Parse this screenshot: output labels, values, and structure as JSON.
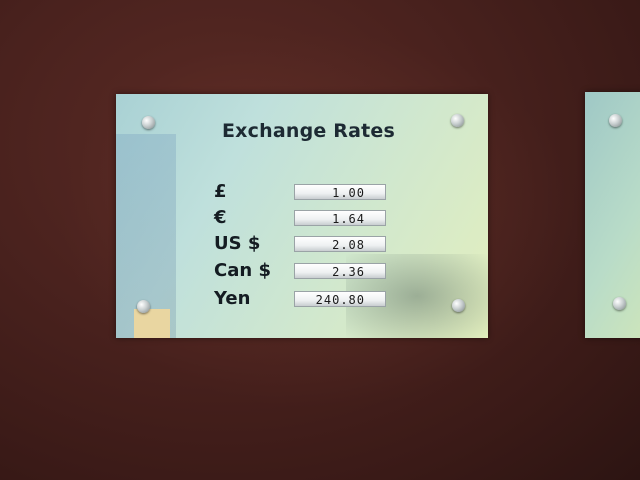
{
  "sign": {
    "title": "Exchange Rates",
    "rates": [
      {
        "label": "£",
        "value": "1.00"
      },
      {
        "label": "€",
        "value": "1.64"
      },
      {
        "label": "US $",
        "value": "2.08"
      },
      {
        "label": "Can $",
        "value": "2.36"
      },
      {
        "label": "Yen",
        "value": "240.80"
      }
    ]
  },
  "colors": {
    "wall": "#4a221e",
    "glass": "#bfe0dc",
    "text": "#141c22",
    "value_strip": "#eef1f2"
  }
}
